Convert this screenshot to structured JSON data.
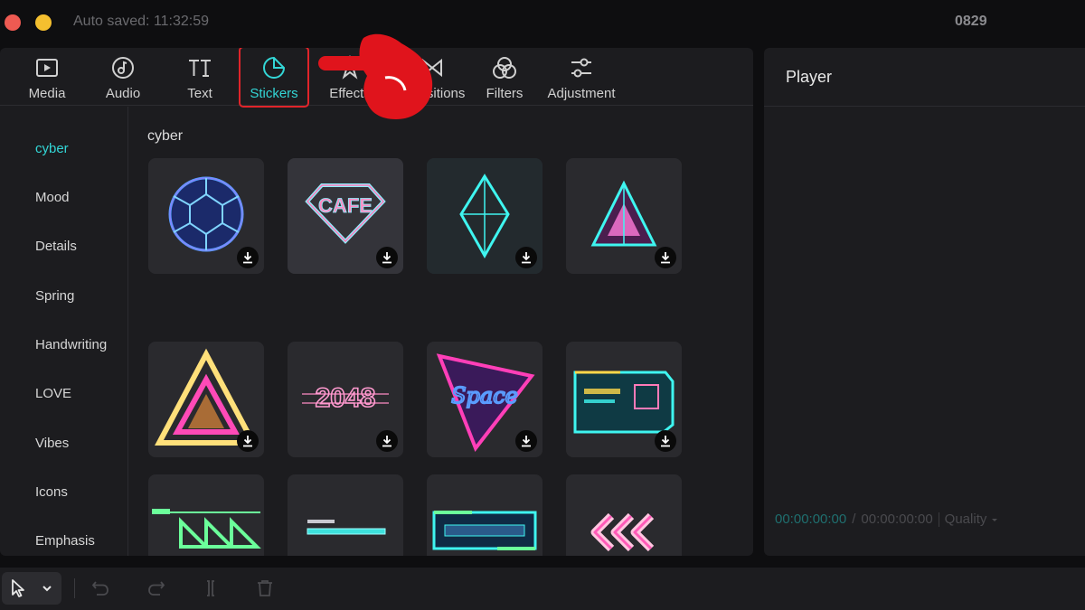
{
  "titlebar": {
    "autosaved": "Auto saved: 11:32:59",
    "project": "0829"
  },
  "toolbar": {
    "tools": [
      {
        "label": "Media",
        "icon": "media-icon"
      },
      {
        "label": "Audio",
        "icon": "audio-icon"
      },
      {
        "label": "Text",
        "icon": "text-icon"
      },
      {
        "label": "Stickers",
        "icon": "stickers-icon",
        "active": true
      },
      {
        "label": "Effects",
        "icon": "effects-icon"
      },
      {
        "label": "Transitions",
        "icon": "transitions-icon"
      },
      {
        "label": "Filters",
        "icon": "filters-icon"
      },
      {
        "label": "Adjustment",
        "icon": "adjustment-icon"
      }
    ]
  },
  "sidebar": {
    "items": [
      "cyber",
      "Mood",
      "Details",
      "Spring",
      "Handwriting",
      "LOVE",
      "Vibes",
      "Icons",
      "Emphasis"
    ],
    "active": "cyber"
  },
  "content": {
    "section_title": "cyber",
    "stickers": [
      {
        "name": "neon-sphere-sticker"
      },
      {
        "name": "cafe-diamond-sticker",
        "text": "CAFE"
      },
      {
        "name": "cyan-crystal-sticker"
      },
      {
        "name": "pink-pyramid-sticker"
      },
      {
        "name": "yellow-triangle-sticker"
      },
      {
        "name": "2048-glitch-sticker",
        "text": "2048"
      },
      {
        "name": "space-triangle-sticker",
        "text": "Space"
      },
      {
        "name": "cyber-panel-sticker"
      },
      {
        "name": "green-arrows-sticker"
      },
      {
        "name": "loading-bar-sticker"
      },
      {
        "name": "cyan-frame-sticker"
      },
      {
        "name": "pink-chevrons-sticker"
      }
    ]
  },
  "player": {
    "title": "Player",
    "current_time": "00:00:00:00",
    "separator": "/",
    "total_time": "00:00:00:00",
    "quality": "Quality"
  },
  "colors": {
    "accent": "#33d6d6",
    "highlight": "#e0242a",
    "panel": "#1c1c1f",
    "background": "#0e0e10"
  }
}
